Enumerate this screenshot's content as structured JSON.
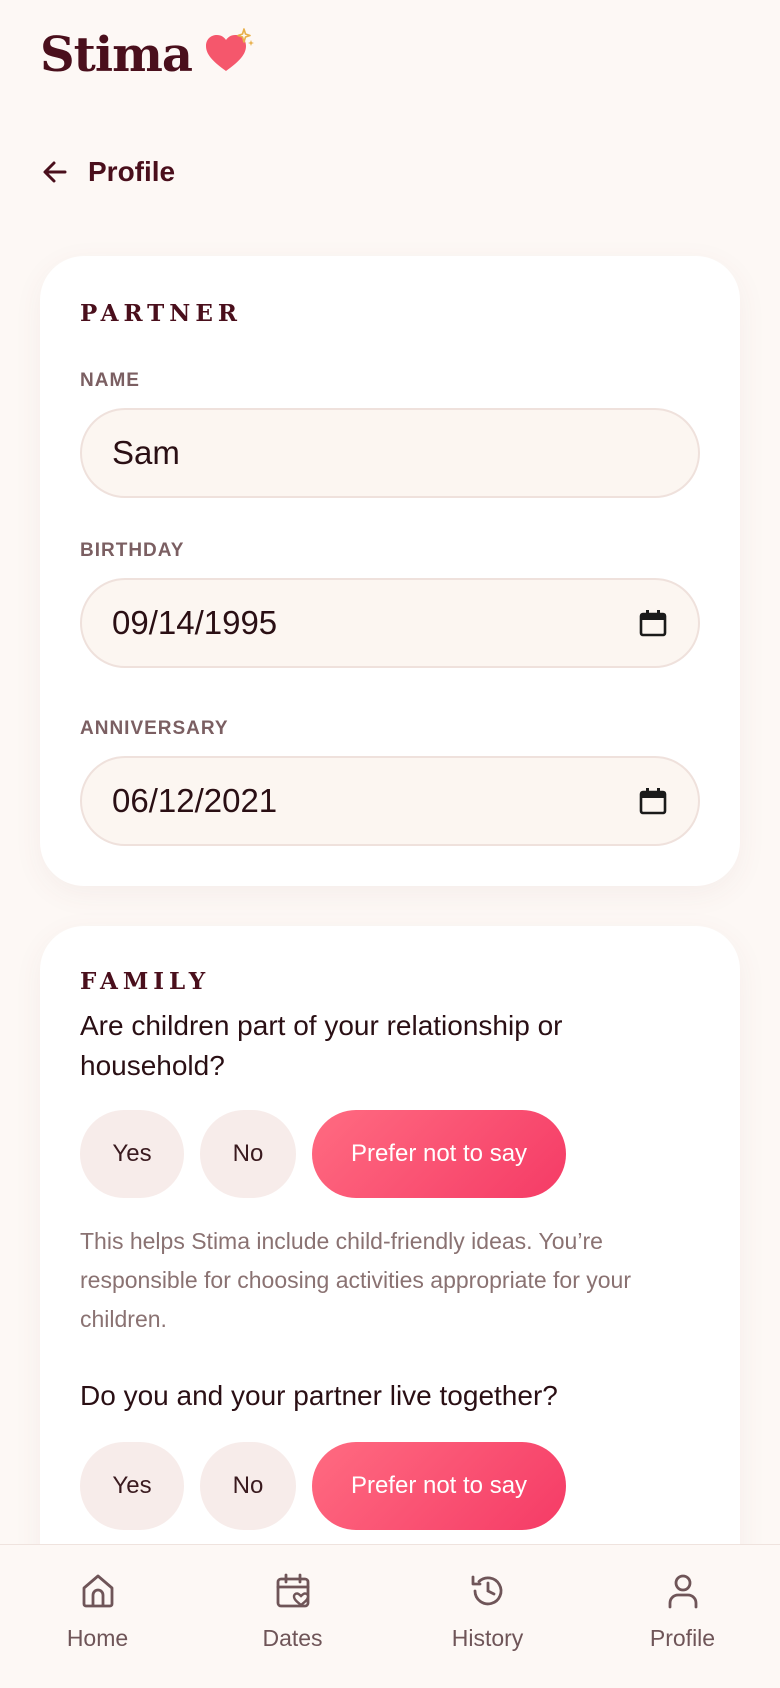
{
  "app": {
    "brand": "Stima",
    "accent": "#f53b66",
    "brand_color": "#4a0f1c"
  },
  "page": {
    "back_icon": "arrow-left-icon",
    "title": "Profile"
  },
  "partner": {
    "section_title": "PARTNER",
    "name_label": "NAME",
    "name_value": "Sam",
    "birthday_label": "BIRTHDAY",
    "birthday_value": "09/14/1995",
    "anniversary_label": "ANNIVERSARY",
    "anniversary_value": "06/12/2021"
  },
  "family": {
    "section_title": "FAMILY",
    "q1": {
      "question": "Are children part of your relationship or household?",
      "options": [
        "Yes",
        "No",
        "Prefer not to say"
      ],
      "selected": "Prefer not to say",
      "helper": "This helps Stima include child-friendly ideas. You’re responsible for choosing activities appropriate for your children."
    },
    "q2": {
      "question": "Do you and your partner live together?",
      "options": [
        "Yes",
        "No",
        "Prefer not to say"
      ],
      "selected": "Prefer not to say"
    }
  },
  "nav": {
    "items": [
      {
        "label": "Home",
        "icon": "home-icon"
      },
      {
        "label": "Dates",
        "icon": "calendar-heart-icon"
      },
      {
        "label": "History",
        "icon": "history-icon"
      },
      {
        "label": "Profile",
        "icon": "user-icon"
      }
    ]
  }
}
